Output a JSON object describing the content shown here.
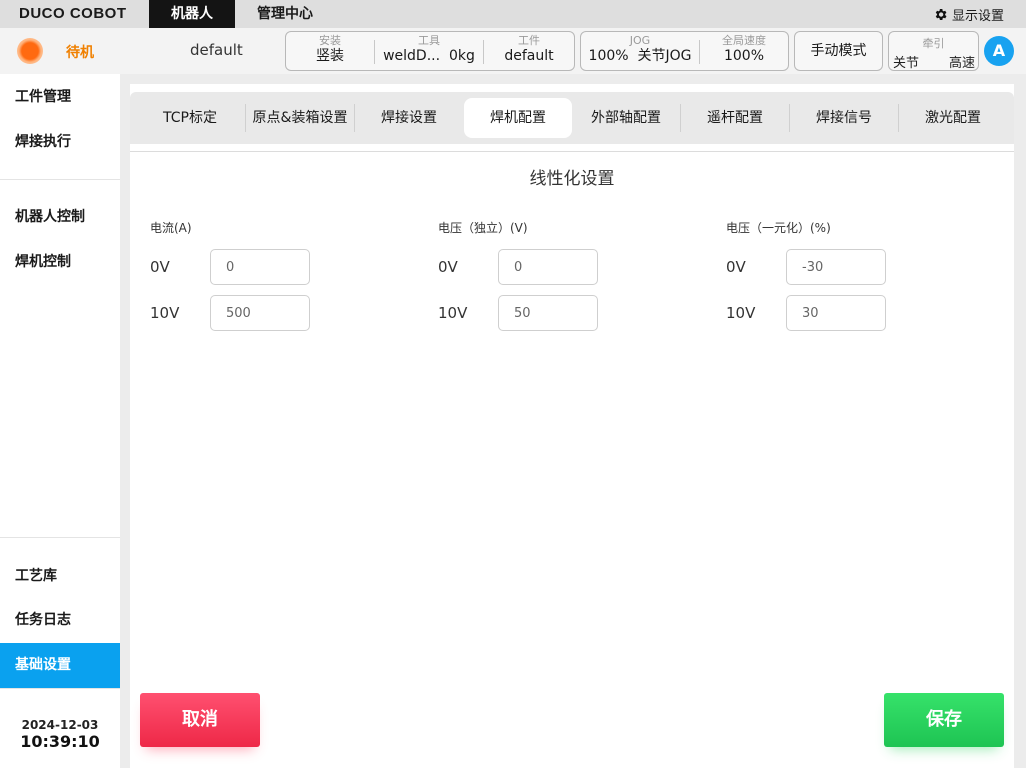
{
  "topbar": {
    "logo": "DUCO COBOT",
    "tabs": [
      "机器人",
      "管理中心"
    ],
    "display_settings": "显示设置"
  },
  "status": {
    "state": "待机",
    "program": "default",
    "install": {
      "label": "安装",
      "value": "竖装"
    },
    "tool": {
      "label": "工具",
      "name": "weldD...",
      "weight": "0kg"
    },
    "workpiece": {
      "label": "工件",
      "value": "default"
    },
    "jog": {
      "label": "JOG",
      "percent": "100%",
      "mode": "关节JOG"
    },
    "global_speed": {
      "label": "全局速度",
      "value": "100%"
    },
    "manual_mode": "手动模式",
    "traction": {
      "label": "牵引",
      "left": "关节",
      "right": "高速"
    },
    "avatar": "A"
  },
  "sidebar": {
    "items": [
      "工件管理",
      "焊接执行",
      "机器人控制",
      "焊机控制",
      "工艺库",
      "任务日志",
      "基础设置"
    ],
    "date": "2024-12-03",
    "time": "10:39:10"
  },
  "tabs": [
    "TCP标定",
    "原点&装箱设置",
    "焊接设置",
    "焊机配置",
    "外部轴配置",
    "遥杆配置",
    "焊接信号",
    "激光配置"
  ],
  "section_title": "线性化设置",
  "groups": [
    {
      "title": "电流(A)",
      "rows": [
        {
          "label": "0V",
          "value": "0"
        },
        {
          "label": "10V",
          "value": "500"
        }
      ]
    },
    {
      "title": "电压（独立）(V)",
      "rows": [
        {
          "label": "0V",
          "value": "0"
        },
        {
          "label": "10V",
          "value": "50"
        }
      ]
    },
    {
      "title": "电压（一元化）(%)",
      "rows": [
        {
          "label": "0V",
          "value": "-30"
        },
        {
          "label": "10V",
          "value": "30"
        }
      ]
    }
  ],
  "buttons": {
    "cancel": "取消",
    "save": "保存"
  }
}
